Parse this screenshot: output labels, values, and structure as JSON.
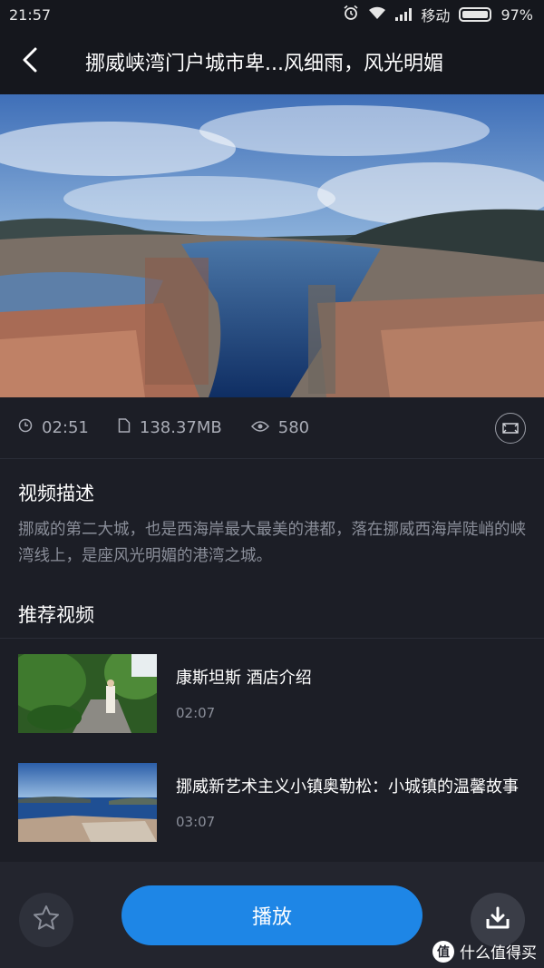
{
  "status": {
    "time": "21:57",
    "carrier": "移动",
    "battery": "97%",
    "battery_level": 0.97
  },
  "header": {
    "title": "挪威峡湾门户城市卑...风细雨，风光明媚",
    "back_icon": "back-arrow-icon"
  },
  "meta": {
    "duration": "02:51",
    "size": "138.37MB",
    "views": "580"
  },
  "description": {
    "heading": "视频描述",
    "text": "挪威的第二大城，也是西海岸最大最美的港都，落在挪威西海岸陡峭的峡湾线上，是座风光明媚的港湾之城。"
  },
  "recommended": {
    "heading": "推荐视频",
    "items": [
      {
        "title": "康斯坦斯 酒店介绍",
        "duration": "02:07"
      },
      {
        "title": "挪威新艺术主义小镇奥勒松：小城镇的温馨故事",
        "duration": "03:07"
      }
    ]
  },
  "actions": {
    "play_label": "播放"
  },
  "watermark": {
    "text": "什么值得买",
    "logo": "值"
  },
  "colors": {
    "accent": "#1e86e6",
    "background": "#1c1e26"
  }
}
